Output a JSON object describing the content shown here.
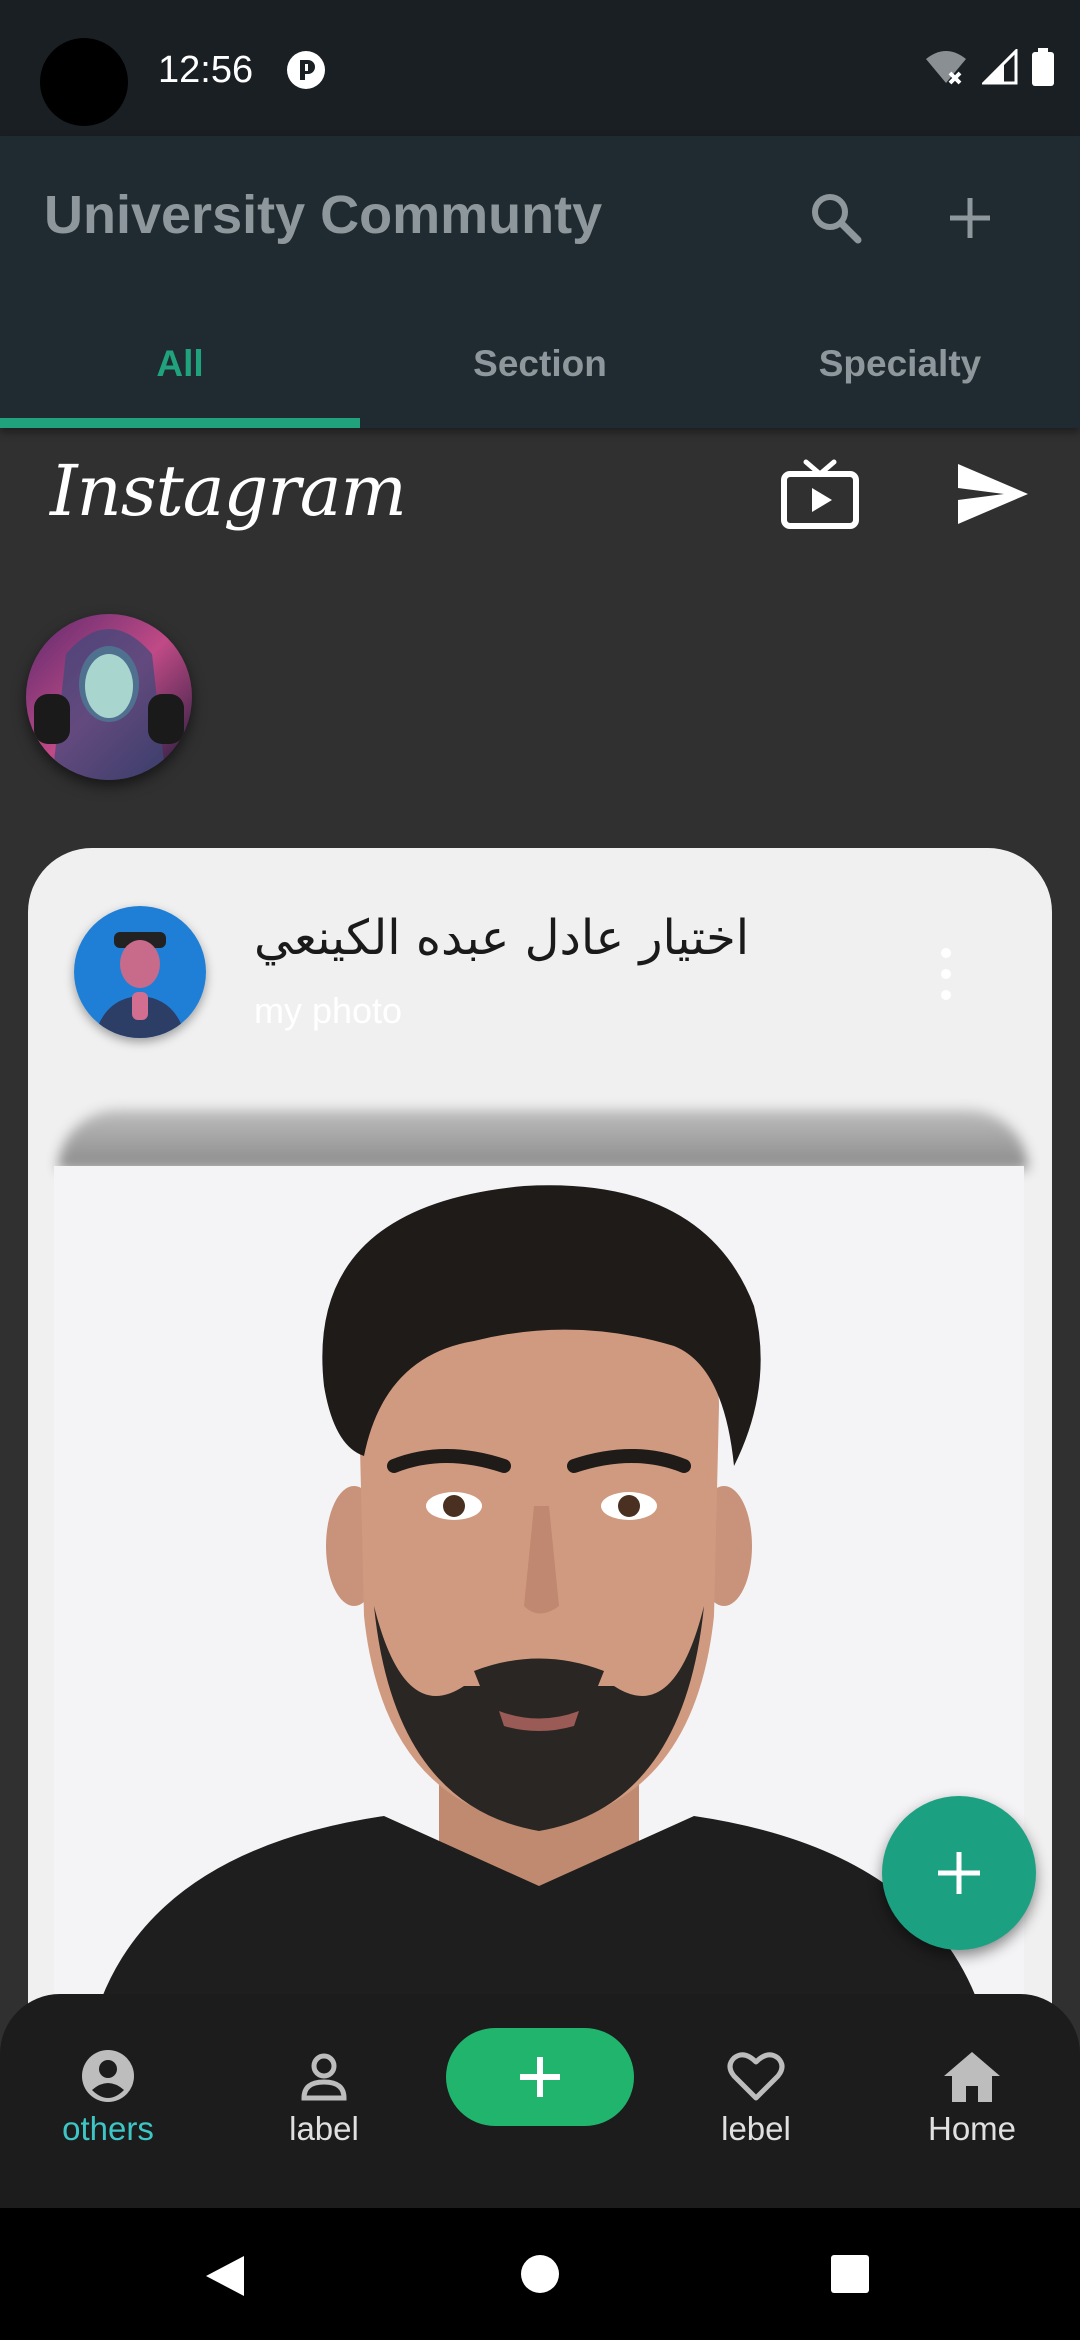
{
  "status_bar": {
    "time": "12:56"
  },
  "app_bar": {
    "title": "University Communty",
    "tabs": [
      {
        "label": "All",
        "active": true
      },
      {
        "label": "Section",
        "active": false
      },
      {
        "label": "Specialty",
        "active": false
      }
    ]
  },
  "instagram": {
    "logo_text": "Instagram"
  },
  "post": {
    "author_name": "اختيار عادل عبده الكينعي",
    "subtitle": "my photo"
  },
  "bottom_nav": {
    "items": [
      {
        "label": "others",
        "icon": "account-circle-icon",
        "active": true
      },
      {
        "label": "label",
        "icon": "person-outline-icon",
        "active": false
      },
      {
        "label": "lebel",
        "icon": "heart-outline-icon",
        "active": false
      },
      {
        "label": "Home",
        "icon": "home-icon",
        "active": false
      }
    ]
  },
  "colors": {
    "accent": "#20a37d",
    "fab": "#1ba181",
    "nav_center": "#21b46d",
    "nav_active": "#3ec6c6",
    "app_bar": "#1f2b31"
  }
}
